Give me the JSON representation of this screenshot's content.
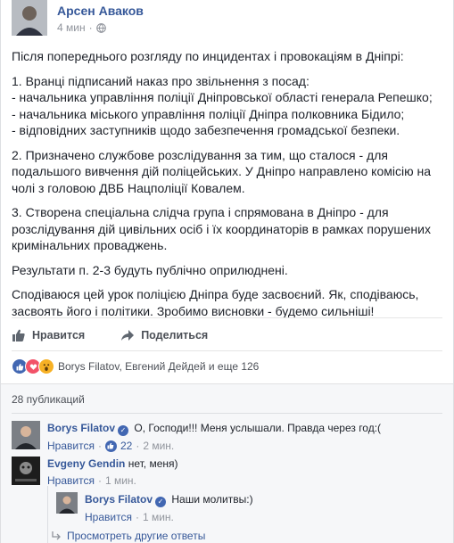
{
  "post": {
    "author": "Арсен Аваков",
    "time": "4 мин",
    "paragraphs": [
      "Після попереднього розгляду по инцидентах і провокаціям в Дніпрі:",
      "1. Вранці підписаний наказ про звільнення з посад:\n- начальника управління поліції Дніпровської області генерала Репешко;\n- начальника міського управління поліції Дніпра полковника Бідило;\n- відповідних заступників щодо забезпечення громадської безпеки.",
      "2. Призначено службове розслідування за тим, що сталося - для подальшого вивчення дій поліцейських. У Дніпро направлено комісію на чолі з головою ДВБ Нацполіції Ковалем.",
      "3. Створена спеціальна слідча група і спрямована в Дніпро - для розслідування дій цивільних осіб і їх координаторів в рамках порушених кримінальних проваджень.",
      "Результати п. 2-3 будуть публічно оприлюднені.",
      "Сподіваюся цей урок поліцією Дніпра буде засвоєний. Як, сподіваюсь, засвоять його і політики. Зробимо висновки - будемо сильніші!"
    ]
  },
  "actions": {
    "like_label": "Нравится",
    "share_label": "Поделиться"
  },
  "reactions": {
    "summary": "Borys Filatov, Евгений Дейдей и еще 126",
    "colors": {
      "like": "#4267b2",
      "love": "#f25268",
      "wow": "#f7b125"
    }
  },
  "comments_header": {
    "count_label": "28 публикаций"
  },
  "comments": [
    {
      "name": "Borys Filatov",
      "verified": true,
      "text": "О, Господи!!! Меня услышали. Правда через год:(",
      "like_label": "Нравится",
      "likes": "22",
      "time": "2 мин."
    },
    {
      "name": "Evgeny Gendin",
      "verified": false,
      "text": "нет, меня)",
      "like_label": "Нравится",
      "time": "1 мин."
    }
  ],
  "reply": {
    "name": "Borys Filatov",
    "verified": true,
    "text": "Наши молитвы:)",
    "like_label": "Нравится",
    "time": "1 мин."
  },
  "more_replies_label": "Просмотреть другие ответы"
}
